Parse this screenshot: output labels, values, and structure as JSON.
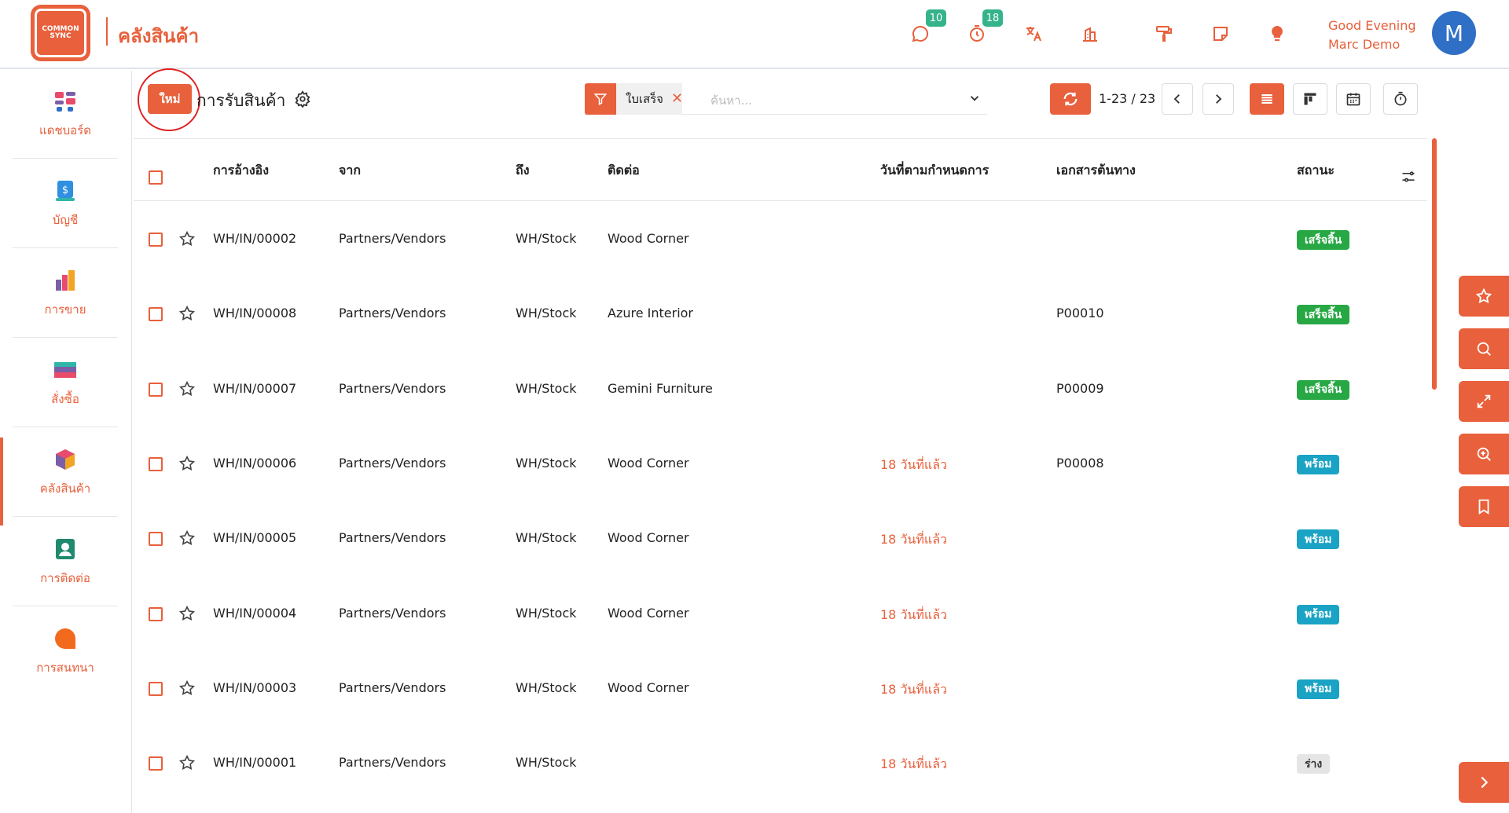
{
  "app": {
    "logo_text": "COMMON SYNC",
    "title": "คลังสินค้า"
  },
  "header": {
    "chat_badge": "10",
    "activity_badge": "18",
    "greeting": "Good Evening",
    "user_name": "Marc Demo",
    "avatar_initial": "M"
  },
  "sidebar": {
    "items": [
      {
        "label": "แดชบอร์ด",
        "icon": "dashboard-icon"
      },
      {
        "label": "บัญชี",
        "icon": "accounting-icon"
      },
      {
        "label": "การขาย",
        "icon": "sales-icon"
      },
      {
        "label": "สั่งซื้อ",
        "icon": "purchase-icon"
      },
      {
        "label": "คลังสินค้า",
        "icon": "inventory-icon"
      },
      {
        "label": "การติดต่อ",
        "icon": "contacts-icon"
      },
      {
        "label": "การสนทนา",
        "icon": "discuss-icon"
      }
    ]
  },
  "control": {
    "new_label": "ใหม่",
    "page_title": "การรับสินค้า",
    "filter_facet": "ใบเสร็จ",
    "search_placeholder": "ค้นหา...",
    "pager": "1-23 / 23"
  },
  "table": {
    "columns": [
      "การอ้างอิง",
      "จาก",
      "ถึง",
      "ติดต่อ",
      "วันที่ตามกำหนดการ",
      "เอกสารต้นทาง",
      "สถานะ"
    ],
    "rows": [
      {
        "ref": "WH/IN/00002",
        "from": "Partners/Vendors",
        "to": "WH/Stock",
        "contact": "Wood Corner",
        "scheduled": "",
        "source": "",
        "status": "เสร็จสิ้น",
        "status_type": "done"
      },
      {
        "ref": "WH/IN/00008",
        "from": "Partners/Vendors",
        "to": "WH/Stock",
        "contact": "Azure Interior",
        "scheduled": "",
        "source": "P00010",
        "status": "เสร็จสิ้น",
        "status_type": "done"
      },
      {
        "ref": "WH/IN/00007",
        "from": "Partners/Vendors",
        "to": "WH/Stock",
        "contact": "Gemini Furniture",
        "scheduled": "",
        "source": "P00009",
        "status": "เสร็จสิ้น",
        "status_type": "done"
      },
      {
        "ref": "WH/IN/00006",
        "from": "Partners/Vendors",
        "to": "WH/Stock",
        "contact": "Wood Corner",
        "scheduled": "18 วันที่แล้ว",
        "source": "P00008",
        "status": "พร้อม",
        "status_type": "ready"
      },
      {
        "ref": "WH/IN/00005",
        "from": "Partners/Vendors",
        "to": "WH/Stock",
        "contact": "Wood Corner",
        "scheduled": "18 วันที่แล้ว",
        "source": "",
        "status": "พร้อม",
        "status_type": "ready"
      },
      {
        "ref": "WH/IN/00004",
        "from": "Partners/Vendors",
        "to": "WH/Stock",
        "contact": "Wood Corner",
        "scheduled": "18 วันที่แล้ว",
        "source": "",
        "status": "พร้อม",
        "status_type": "ready"
      },
      {
        "ref": "WH/IN/00003",
        "from": "Partners/Vendors",
        "to": "WH/Stock",
        "contact": "Wood Corner",
        "scheduled": "18 วันที่แล้ว",
        "source": "",
        "status": "พร้อม",
        "status_type": "ready"
      },
      {
        "ref": "WH/IN/00001",
        "from": "Partners/Vendors",
        "to": "WH/Stock",
        "contact": "",
        "scheduled": "18 วันที่แล้ว",
        "source": "",
        "status": "ร่าง",
        "status_type": "draft"
      }
    ]
  },
  "colors": {
    "accent": "#e8603c",
    "done": "#27a844",
    "ready": "#1aa3c4",
    "avatar": "#2f6fc6"
  }
}
